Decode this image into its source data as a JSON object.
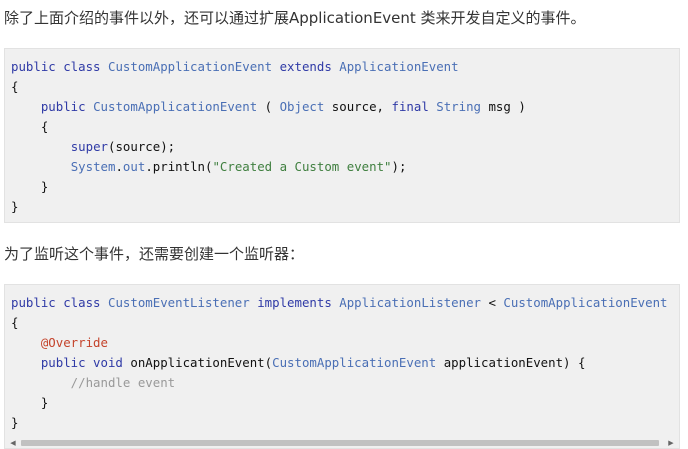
{
  "intro1": "除了上面介绍的事件以外，还可以通过扩展ApplicationEvent 类来开发自定义的事件。",
  "intro2": "为了监听这个事件，还需要创建一个监听器：",
  "code1": [
    [
      {
        "t": "public class ",
        "c": "kw"
      },
      {
        "t": "CustomApplicationEvent",
        "c": "ty"
      },
      {
        "t": " extends ",
        "c": "kw"
      },
      {
        "t": "ApplicationEvent",
        "c": "ty"
      }
    ],
    [
      {
        "t": "{",
        "c": "pl"
      }
    ],
    [
      {
        "t": "    public ",
        "c": "kw"
      },
      {
        "t": "CustomApplicationEvent",
        "c": "ty"
      },
      {
        "t": " ( ",
        "c": "pl"
      },
      {
        "t": "Object",
        "c": "ty"
      },
      {
        "t": " source, ",
        "c": "pl"
      },
      {
        "t": "final ",
        "c": "kw"
      },
      {
        "t": "String",
        "c": "ty"
      },
      {
        "t": " msg )",
        "c": "pl"
      }
    ],
    [
      {
        "t": "    {",
        "c": "pl"
      }
    ],
    [
      {
        "t": "        ",
        "c": "pl"
      },
      {
        "t": "super",
        "c": "kw"
      },
      {
        "t": "(source);",
        "c": "pl"
      }
    ],
    [
      {
        "t": "        ",
        "c": "pl"
      },
      {
        "t": "System",
        "c": "ty"
      },
      {
        "t": ".",
        "c": "pl"
      },
      {
        "t": "out",
        "c": "ty"
      },
      {
        "t": ".println(",
        "c": "pl"
      },
      {
        "t": "\"Created a Custom event\"",
        "c": "str"
      },
      {
        "t": ");",
        "c": "pl"
      }
    ],
    [
      {
        "t": "    }",
        "c": "pl"
      }
    ],
    [
      {
        "t": "}",
        "c": "pl"
      }
    ]
  ],
  "code2": [
    [
      {
        "t": "public class ",
        "c": "kw"
      },
      {
        "t": "CustomEventListener",
        "c": "ty"
      },
      {
        "t": " implements ",
        "c": "kw"
      },
      {
        "t": "ApplicationListener",
        "c": "ty"
      },
      {
        "t": " < ",
        "c": "pl"
      },
      {
        "t": "CustomApplicationEvent",
        "c": "ty"
      }
    ],
    [
      {
        "t": "{",
        "c": "pl"
      }
    ],
    [
      {
        "t": "    ",
        "c": "pl"
      },
      {
        "t": "@Override",
        "c": "ann"
      }
    ],
    [
      {
        "t": "    public void ",
        "c": "kw"
      },
      {
        "t": "onApplicationEvent(",
        "c": "pl"
      },
      {
        "t": "CustomApplicationEvent",
        "c": "ty"
      },
      {
        "t": " applicationEvent) {",
        "c": "pl"
      }
    ],
    [
      {
        "t": "        //handle event",
        "c": "cmt"
      }
    ],
    [
      {
        "t": "    }",
        "c": "pl"
      }
    ],
    [
      {
        "t": "}",
        "c": "pl"
      }
    ]
  ],
  "scrollbar": {
    "left_arrow": "◀",
    "right_arrow": "▶"
  }
}
